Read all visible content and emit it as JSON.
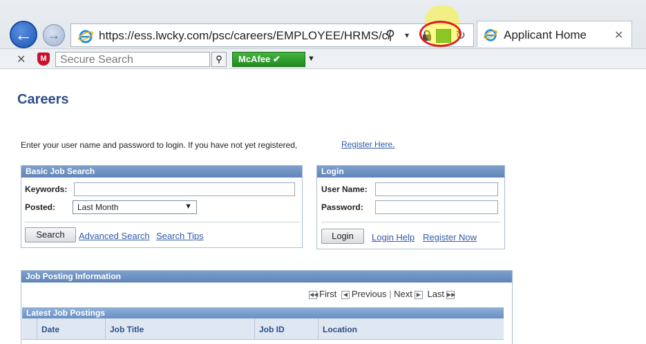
{
  "browser": {
    "url": "https://ess.lwcky.com/psc/careers/EMPLOYEE/HRMS/c/",
    "tab_title": "Applicant Home"
  },
  "toolbar": {
    "search_placeholder": "Secure Search",
    "mcafee_label": "McAfee"
  },
  "page": {
    "title": "Careers",
    "intro": "Enter your user name and password to login. If you have not yet registered,",
    "register_link": "Register Here."
  },
  "job_search": {
    "header": "Basic Job Search",
    "keywords_label": "Keywords:",
    "posted_label": "Posted:",
    "posted_value": "Last Month",
    "search_button": "Search",
    "advanced_link": "Advanced Search",
    "tips_link": "Search Tips"
  },
  "login": {
    "header": "Login",
    "username_label": "User Name:",
    "password_label": "Password:",
    "login_button": "Login",
    "help_link": "Login Help",
    "register_link": "Register Now"
  },
  "postings": {
    "header": "Job Posting Information",
    "pager": {
      "first": "First",
      "previous": "Previous",
      "next": "Next",
      "last": "Last"
    },
    "sub_header": "Latest Job Postings",
    "columns": [
      "Date",
      "Job Title",
      "Job ID",
      "Location"
    ]
  },
  "colors": {
    "title_blue": "#2d4e86",
    "panel_header": "#6b8fc3",
    "link_blue": "#2f5aa8",
    "annotation_red": "#e01b24",
    "highlight_yellow": "#fff500"
  }
}
